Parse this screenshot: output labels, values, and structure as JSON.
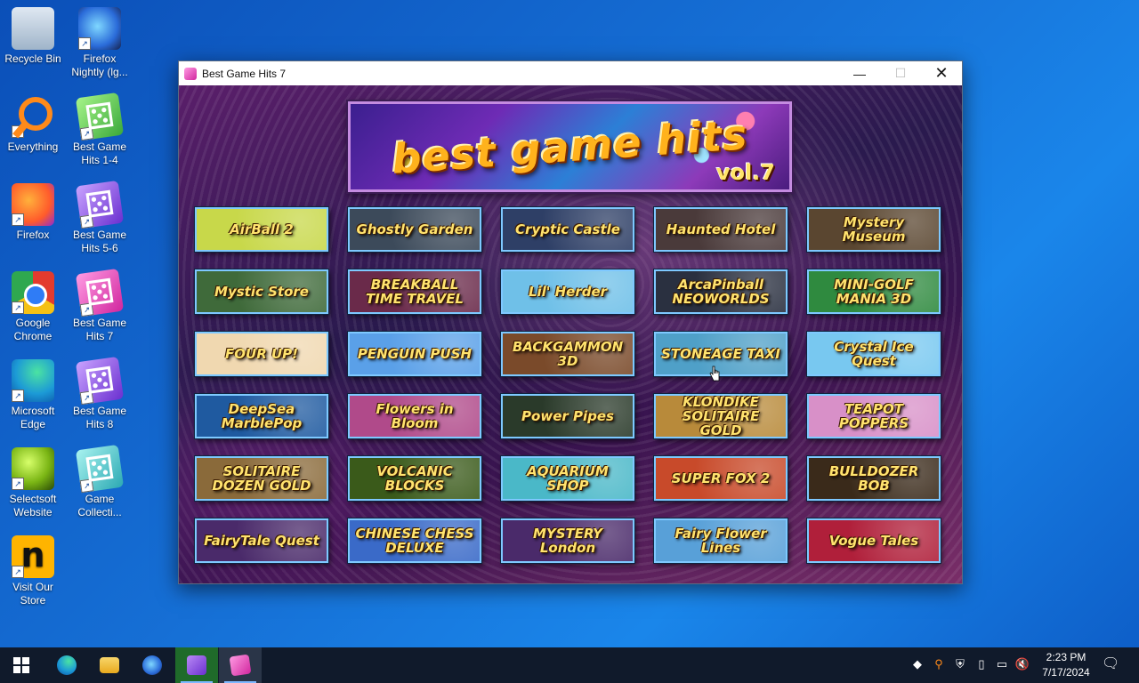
{
  "desktop": {
    "icons": [
      {
        "label": "Recycle Bin",
        "icon": "recycle-bin-icon"
      },
      {
        "label": "Firefox Nightly (lg...",
        "icon": "firefox-nightly-icon"
      },
      {
        "label": "Everything",
        "icon": "everything-search-icon"
      },
      {
        "label": "Best Game Hits 1-4",
        "icon": "dice-icon"
      },
      {
        "label": "Firefox",
        "icon": "firefox-icon"
      },
      {
        "label": "Best Game Hits 5-6",
        "icon": "dice-icon"
      },
      {
        "label": "Google Chrome",
        "icon": "chrome-icon"
      },
      {
        "label": "Best Game Hits 7",
        "icon": "dice-icon"
      },
      {
        "label": "Microsoft Edge",
        "icon": "edge-icon"
      },
      {
        "label": "Best Game Hits 8",
        "icon": "dice-icon"
      },
      {
        "label": "Selectsoft Website",
        "icon": "selectsoft-icon"
      },
      {
        "label": "Game Collecti...",
        "icon": "dice-icon"
      },
      {
        "label": "Visit Our Store",
        "icon": "store-icon"
      }
    ]
  },
  "window": {
    "title": "Best Game Hits 7",
    "controls": {
      "minimize": "—",
      "maximize": "☐",
      "close": "✕"
    }
  },
  "banner": {
    "title": "best game hits",
    "volume": "vol.7"
  },
  "games": [
    {
      "title": "AirBall 2",
      "bg": "#c8d84a"
    },
    {
      "title": "Ghostly Garden",
      "bg": "#3c4a5a"
    },
    {
      "title": "Cryptic Castle",
      "bg": "#2e3f66"
    },
    {
      "title": "Haunted Hotel",
      "bg": "#4a3a3a"
    },
    {
      "title": "Mystery Museum",
      "bg": "#5a4630"
    },
    {
      "title": "Mystic Store",
      "bg": "#3f6a3a"
    },
    {
      "title": "BREAKBALL TIME TRAVEL",
      "bg": "#6a2a4a"
    },
    {
      "title": "Lil' Herder",
      "bg": "#6fc0e8"
    },
    {
      "title": "ArcaPinball NEOWORLDS",
      "bg": "#2a3040"
    },
    {
      "title": "MINI-GOLF MANIA 3D",
      "bg": "#2f8a3f"
    },
    {
      "title": "FOUR UP!",
      "bg": "#f0d8b0"
    },
    {
      "title": "PENGUIN PUSH",
      "bg": "#5aa0e8"
    },
    {
      "title": "BACKGAMMON 3D",
      "bg": "#7a4a2a"
    },
    {
      "title": "STONEAGE TAXI",
      "bg": "#4fa0c8"
    },
    {
      "title": "Crystal Ice Quest",
      "bg": "#78c8f0"
    },
    {
      "title": "DeepSea MarblePop",
      "bg": "#1f5aa0"
    },
    {
      "title": "Flowers in Bloom",
      "bg": "#b04a8a"
    },
    {
      "title": "Power Pipes",
      "bg": "#2a3a2a"
    },
    {
      "title": "KLONDIKE SOLITAIRE GOLD",
      "bg": "#b88a3a"
    },
    {
      "title": "TEAPOT POPPERS",
      "bg": "#d890c8"
    },
    {
      "title": "SOLITAIRE DOZEN GOLD",
      "bg": "#8a6a3a"
    },
    {
      "title": "VOLCANIC BLOCKS",
      "bg": "#3a5a1a"
    },
    {
      "title": "AQUARIUM SHOP",
      "bg": "#4ab8c8"
    },
    {
      "title": "SUPER FOX 2",
      "bg": "#c84a2a"
    },
    {
      "title": "BULLDOZER BOB",
      "bg": "#3a2a1a"
    },
    {
      "title": "FairyTale Quest",
      "bg": "#4a2a6a"
    },
    {
      "title": "CHINESE CHESS DELUXE",
      "bg": "#3a6ac8"
    },
    {
      "title": "MYSTERY London",
      "bg": "#4a2a6a"
    },
    {
      "title": "Fairy Flower Lines",
      "bg": "#58a0d8"
    },
    {
      "title": "Vogue Tales",
      "bg": "#b01f3a"
    }
  ],
  "taskbar": {
    "apps": [
      {
        "name": "start",
        "icon": "windows-start-icon"
      },
      {
        "name": "Microsoft Edge",
        "icon": "edge-icon",
        "color": "#1c9ad6"
      },
      {
        "name": "File Explorer",
        "icon": "folder-icon",
        "color": "#f5c542"
      },
      {
        "name": "Firefox Nightly",
        "icon": "firefox-nightly-icon",
        "color": "#2a6bd9"
      },
      {
        "name": "Visual Studio",
        "icon": "visual-studio-icon",
        "color": "#8b4fd8"
      },
      {
        "name": "Best Game Hits 7",
        "icon": "dice-icon",
        "color": "#d1269e"
      }
    ],
    "tray": [
      "color-icon",
      "search-orange-icon",
      "defender-icon",
      "usb-icon",
      "network-icon",
      "volume-muted-icon"
    ],
    "time": "2:23 PM",
    "date": "7/17/2024",
    "notification": "notification-icon"
  }
}
